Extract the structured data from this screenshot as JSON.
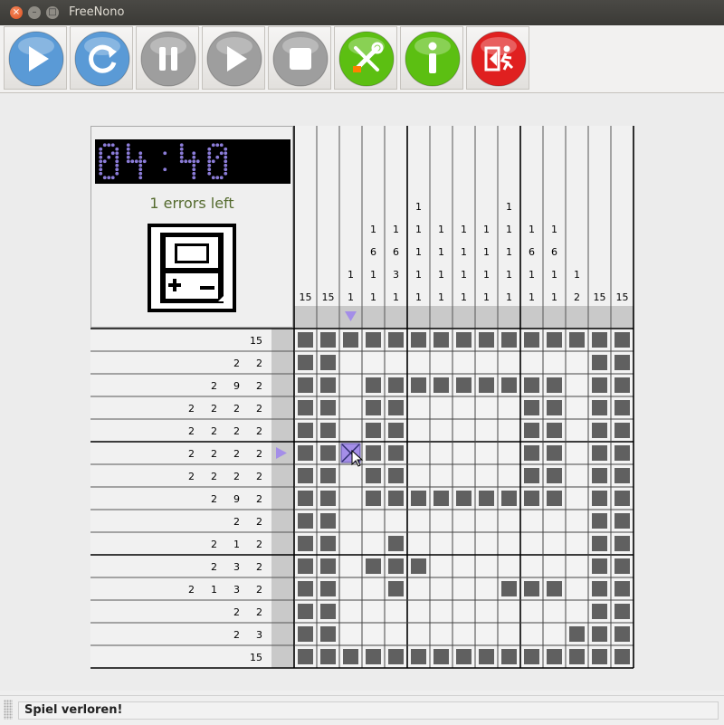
{
  "window": {
    "title": "FreeNono",
    "close_glyph": "×",
    "minimize_glyph": "–",
    "maximize_glyph": "□"
  },
  "toolbar": {
    "buttons": [
      {
        "name": "start-game",
        "icon": "play-icon",
        "enabled": true,
        "color": "#5a9ad6"
      },
      {
        "name": "restart-game",
        "icon": "restart-icon",
        "enabled": true,
        "color": "#5a9ad6"
      },
      {
        "name": "pause-game",
        "icon": "pause-icon",
        "enabled": false,
        "color": "#9e9e9e"
      },
      {
        "name": "resume-game",
        "icon": "play-icon",
        "enabled": false,
        "color": "#9e9e9e"
      },
      {
        "name": "stop-game",
        "icon": "stop-icon",
        "enabled": false,
        "color": "#9e9e9e"
      },
      {
        "name": "settings",
        "icon": "tools-icon",
        "enabled": true,
        "color": "#5cbf12"
      },
      {
        "name": "about",
        "icon": "info-icon",
        "enabled": true,
        "color": "#5cbf12"
      },
      {
        "name": "exit",
        "icon": "exit-icon",
        "enabled": true,
        "color": "#e02020"
      }
    ]
  },
  "info": {
    "time": "04:40",
    "errors_left": "1 errors left",
    "icon": "gameboy-icon",
    "clock_dot_color": "#8b7cd8"
  },
  "puzzle": {
    "columns": 15,
    "rows": 15,
    "column_clues": [
      [
        "15"
      ],
      [
        "15"
      ],
      [
        "1",
        "1"
      ],
      [
        "1",
        "6",
        "1",
        "1"
      ],
      [
        "1",
        "6",
        "3",
        "1"
      ],
      [
        "1",
        "1",
        "1",
        "1",
        "1"
      ],
      [
        "1",
        "1",
        "1",
        "1"
      ],
      [
        "1",
        "1",
        "1",
        "1"
      ],
      [
        "1",
        "1",
        "1",
        "1"
      ],
      [
        "1",
        "1",
        "1",
        "1",
        "1"
      ],
      [
        "1",
        "6",
        "1",
        "1"
      ],
      [
        "1",
        "6",
        "1",
        "1"
      ],
      [
        "1",
        "2"
      ],
      [
        "15"
      ],
      [
        "15"
      ]
    ],
    "row_clues": [
      [
        "15"
      ],
      [
        "2",
        "2"
      ],
      [
        "2",
        "9",
        "2"
      ],
      [
        "2",
        "2",
        "2",
        "2"
      ],
      [
        "2",
        "2",
        "2",
        "2"
      ],
      [
        "2",
        "2",
        "2",
        "2"
      ],
      [
        "2",
        "2",
        "2",
        "2"
      ],
      [
        "2",
        "9",
        "2"
      ],
      [
        "2",
        "2"
      ],
      [
        "2",
        "1",
        "2"
      ],
      [
        "2",
        "3",
        "2"
      ],
      [
        "2",
        "1",
        "3",
        "2"
      ],
      [
        "2",
        "2"
      ],
      [
        "2",
        "3"
      ],
      [
        "15"
      ]
    ],
    "cells": [
      "111111111111111",
      "110000000000011",
      "110111111111011",
      "110110000011011",
      "110110000011011",
      "11X110000011011",
      "110110000011011",
      "110111111111011",
      "110000000000011",
      "110010000000011",
      "110111000000011",
      "110010000111011",
      "110000000000011",
      "110000000000111",
      "111111111111111"
    ],
    "cursor_row": 5,
    "cursor_col": 2,
    "filled_color": "#606060",
    "marker_color": "#a48ee8"
  },
  "status": {
    "text": "Spiel verloren!"
  }
}
